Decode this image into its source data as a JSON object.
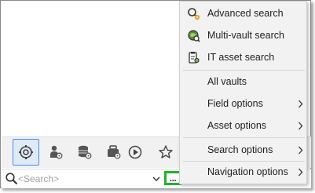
{
  "search": {
    "placeholder": "<Search>",
    "more_label": "..."
  },
  "toolbar": {
    "buttons": [
      {
        "icon": "search-settings-icon",
        "active": true
      },
      {
        "icon": "user-settings-icon",
        "active": false
      },
      {
        "icon": "database-settings-icon",
        "active": false
      },
      {
        "icon": "bag-icon",
        "active": false
      },
      {
        "icon": "play-icon",
        "active": false
      },
      {
        "icon": "star-icon",
        "active": false
      }
    ]
  },
  "menu": {
    "items": [
      {
        "label": "Advanced search",
        "icon": "advanced-search-icon",
        "submenu": false
      },
      {
        "label": "Multi-vault search",
        "icon": "multi-vault-search-icon",
        "submenu": false
      },
      {
        "label": "IT asset search",
        "icon": "it-asset-search-icon",
        "submenu": false
      },
      {
        "label": "All vaults",
        "icon": "",
        "submenu": false
      },
      {
        "label": "Field options",
        "icon": "",
        "submenu": true
      },
      {
        "label": "Asset options",
        "icon": "",
        "submenu": true
      },
      {
        "label": "Search options",
        "icon": "",
        "submenu": true
      },
      {
        "label": "Navigation options",
        "icon": "",
        "submenu": true
      }
    ]
  },
  "colors": {
    "highlight_border": "#1db52c",
    "active_button_border": "#4d8ddb"
  }
}
